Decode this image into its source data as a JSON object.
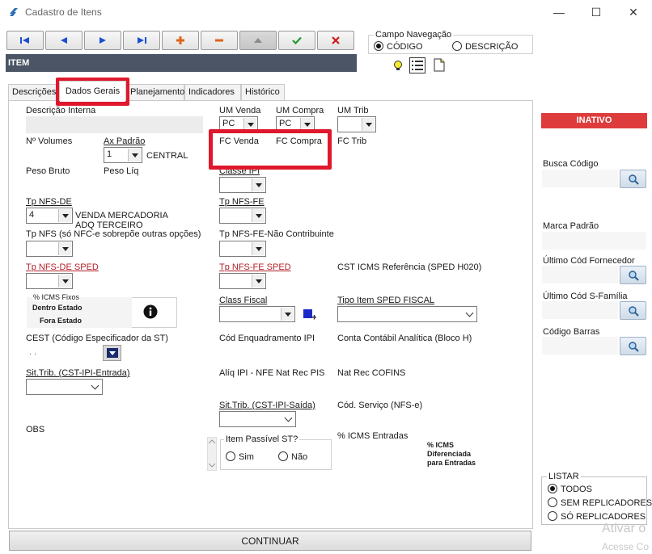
{
  "window": {
    "title": "Cadastro de Itens",
    "minimize": "—",
    "maximize": "☐",
    "close": "✕"
  },
  "toolbar": {
    "first": "first-record",
    "prev": "previous-record",
    "next": "next-record",
    "last": "last-record",
    "add": "+",
    "remove": "−",
    "up": "up",
    "confirm": "✔",
    "cancel": "✖"
  },
  "campo_navegacao": {
    "title": "Campo Navegação",
    "codigo": "CÓDIGO",
    "descricao": "DESCRIÇÃO",
    "selected": "CÓDIGO"
  },
  "item_bar": "ITEM",
  "tabs": [
    "Descrições",
    "Dados Gerais",
    "Planejamento",
    "Indicadores",
    "Histórico"
  ],
  "active_tab": "Dados Gerais",
  "form": {
    "descricao_interna": "Descrição Interna",
    "um_venda": "UM Venda",
    "um_venda_value": "PC",
    "um_compra": "UM Compra",
    "um_compra_value": "PC",
    "um_trib": "UM Trib",
    "num_volumes": "Nº Volumes",
    "ax_padrao": "Ax Padrão",
    "ax_padrao_value": "1",
    "ax_padrao_desc": "CENTRAL",
    "fc_venda": "FC Venda",
    "fc_compra": "FC Compra",
    "fc_trib": "FC Trib",
    "peso_bruto": "Peso Bruto",
    "peso_liq": "Peso Líq",
    "classe_ipi": "Classe IPI",
    "tp_nfs_de": "Tp NFS-DE",
    "tp_nfs_de_value": "4",
    "tp_nfs_de_desc": "VENDA MERCADORIA ADQ TERCEIRO",
    "tp_nfs_fe": "Tp NFS-FE",
    "tp_nfs": "Tp NFS  (só NFC-e sobrepõe outras opções)",
    "tp_nfs_fe_nc": "Tp NFS-FE-Não Contribuinte",
    "tp_nfs_de_sped": "Tp NFS-DE  SPED",
    "tp_nfs_fe_sped": "Tp NFS-FE  SPED",
    "cst_icms_ref": "CST ICMS Referência (SPED H020)",
    "icms_fixos": "% ICMS Fixos",
    "dentro_estado": "Dentro Estado",
    "fora_estado": "Fora Estado",
    "class_fiscal": "Class Fiscal",
    "tipo_item_sped": "Tipo Item SPED FISCAL",
    "cest": "CEST (Código Especificador da ST)",
    "cest_value": ". .",
    "cod_enquadramento_ipi": "Cód Enquadramento IPI",
    "conta_contabil": "Conta Contábil Analítica (Bloco H)",
    "sit_trib_entrada": "Sit.Trib. (CST-IPI-Entrada)",
    "aliq_ipi_nfe": "Alíq IPI - NFE",
    "nat_rec_pis": "Nat  Rec  PIS",
    "nat_rec_cofins": "Nat  Rec  COFINS",
    "sit_trib_saida": "Sit.Trib. (CST-IPI-Saída)",
    "cod_servico": "Cód. Serviço (NFS-e)",
    "obs": "OBS",
    "item_passivel_st": "Item Passível ST?",
    "sim": "Sim",
    "nao": "Não",
    "icms_entradas": "% ICMS Entradas",
    "icms_diferenciada_1": "% ICMS",
    "icms_diferenciada_2": "Diferenciada",
    "icms_diferenciada_3": "para Entradas"
  },
  "right_panel": {
    "status": "INATIVO",
    "busca_codigo": "Busca Código",
    "marca_padrao": "Marca Padrão",
    "ultimo_cod_fornecedor": "Último Cód Fornecedor",
    "ultimo_cod_sfamilia": "Último Cód S-Família",
    "codigo_barras": "Código Barras"
  },
  "listar": {
    "title": "LISTAR",
    "todos": "TODOS",
    "sem_replicadores": "SEM REPLICADORES",
    "so_replicadores": "SÓ REPLICADORES",
    "selected": "TODOS"
  },
  "continuar": "CONTINUAR",
  "watermark": {
    "line1": "Ativar o",
    "line2": "Acesse Co"
  },
  "colors": {
    "highlight": "#e0182d",
    "status_inactive": "#de3c3c",
    "item_bar": "#4b5566",
    "sped_label": "#b3202a"
  }
}
